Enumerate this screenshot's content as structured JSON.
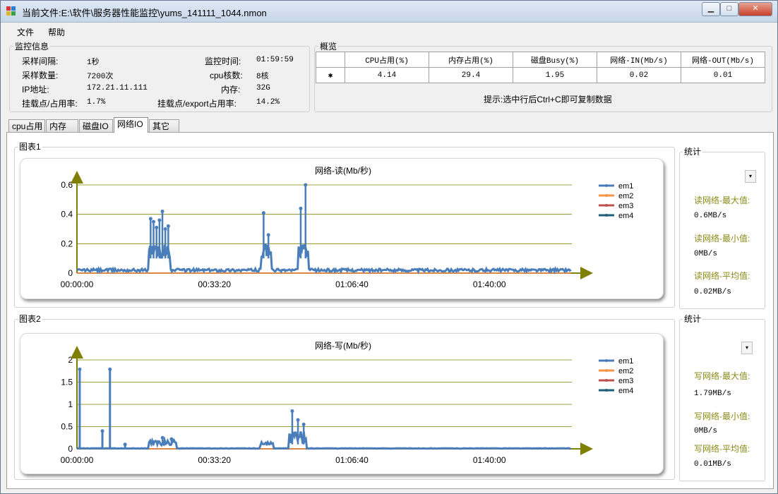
{
  "window": {
    "title": "当前文件:E:\\软件\\服务器性能监控\\yums_141111_1044.nmon",
    "min_glyph": "▁",
    "max_glyph": "□",
    "close_glyph": "✕"
  },
  "menu": {
    "file": "文件",
    "help": "帮助"
  },
  "monitor": {
    "title": "监控信息",
    "interval_label": "采样间隔:",
    "interval_value": "1秒",
    "count_label": "采样数量:",
    "count_value": "7200次",
    "ip_label": "IP地址:",
    "ip_value": "172.21.11.111",
    "mount_label": "挂载点/占用率:",
    "mount_value": "1.7%",
    "time_label": "监控时间:",
    "time_value": "01:59:59",
    "cpu_label": "cpu核数:",
    "cpu_value": "8核",
    "mem_label": "内存:",
    "mem_value": "32G",
    "export_label": "挂载点/export占用率:",
    "export_value": "14.2%"
  },
  "overview": {
    "title": "概览",
    "columns": [
      "CPU占用(%)",
      "内存占用(%)",
      "磁盘Busy(%)",
      "网络-IN(Mb/s)",
      "网络-OUT(Mb/s)"
    ],
    "row_marker": "✱",
    "values": [
      "4.14",
      "29.4",
      "1.95",
      "0.02",
      "0.01"
    ],
    "hint": "提示:选中行后Ctrl+C即可复制数据"
  },
  "tabs": [
    "cpu占用",
    "内存",
    "磁盘IO",
    "网络IO",
    "其它"
  ],
  "active_tab": 3,
  "colors": {
    "em1": "#4a7ebb",
    "em2": "#f79646",
    "em3": "#c0504d",
    "em4": "#1f5f7a",
    "gridline": "#808000",
    "axis_arrow": "#808000"
  },
  "chart1": {
    "group": "图表1",
    "stats_title": "统计",
    "dropdown_glyph": "▾",
    "max_label": "读网络-最大值:",
    "max_value": "0.6MB/s",
    "min_label": "读网络-最小值:",
    "min_value": "0MB/s",
    "avg_label": "读网络-平均值:",
    "avg_value": "0.02MB/s"
  },
  "chart2": {
    "group": "图表2",
    "stats_title": "统计",
    "dropdown_glyph": "▾",
    "max_label": "写网络-最大值:",
    "max_value": "1.79MB/s",
    "min_label": "写网络-最小值:",
    "min_value": "0MB/s",
    "avg_label": "写网络-平均值:",
    "avg_value": "0.01MB/s"
  },
  "chart_data": [
    {
      "type": "line",
      "title": "网络-读(Mb/秒)",
      "xlabel": "",
      "ylabel": "",
      "xlim": [
        "00:00:00",
        "01:59:59"
      ],
      "x_ticks": [
        "00:00:00",
        "00:33:20",
        "01:06:40",
        "01:40:00"
      ],
      "ylim": [
        0,
        0.6
      ],
      "y_ticks": [
        "0",
        "0.2",
        "0.4",
        "0.6"
      ],
      "grid": true,
      "legend": "top-right",
      "series": [
        {
          "name": "em1",
          "baseline": 0.02,
          "bursts": [
            {
              "from": "00:17:30",
              "to": "00:22:30",
              "low": 0.1,
              "high": 0.2,
              "peaks": [
                0.37,
                0.35,
                0.31,
                0.36,
                0.42,
                0.3,
                0.32
              ]
            },
            {
              "from": "00:44:40",
              "to": "00:47:00",
              "low": 0.1,
              "high": 0.2,
              "peaks": [
                0.41,
                0.26
              ]
            },
            {
              "from": "00:53:40",
              "to": "00:56:00",
              "low": 0.1,
              "high": 0.2,
              "peaks": [
                0.44,
                0.6
              ]
            }
          ]
        },
        {
          "name": "em2",
          "baseline": 0
        },
        {
          "name": "em3",
          "baseline": 0
        },
        {
          "name": "em4",
          "baseline": 0
        }
      ]
    },
    {
      "type": "line",
      "title": "网络-写(Mb/秒)",
      "xlabel": "",
      "ylabel": "",
      "xlim": [
        "00:00:00",
        "01:59:59"
      ],
      "x_ticks": [
        "00:00:00",
        "00:33:20",
        "01:06:40",
        "01:40:00"
      ],
      "ylim": [
        0,
        2
      ],
      "y_ticks": [
        "0",
        "0.5",
        "1",
        "1.5",
        "2"
      ],
      "grid": true,
      "legend": "top-right",
      "series": [
        {
          "name": "em1",
          "baseline": 0.01,
          "spikes": [
            {
              "t": "00:00:40",
              "v": 1.79
            },
            {
              "t": "00:06:10",
              "v": 0.4
            },
            {
              "t": "00:08:00",
              "v": 1.79
            },
            {
              "t": "00:11:40",
              "v": 0.1
            }
          ],
          "bursts": [
            {
              "from": "00:17:30",
              "to": "00:24:00",
              "low": 0.08,
              "high": 0.2,
              "peaks": [
                0.15,
                0.25,
                0.22
              ]
            },
            {
              "from": "00:44:30",
              "to": "00:47:30",
              "low": 0.08,
              "high": 0.15,
              "peaks": [
                0.12
              ]
            },
            {
              "from": "00:51:30",
              "to": "00:55:40",
              "low": 0.1,
              "high": 0.4,
              "peaks": [
                0.85,
                0.65,
                0.55
              ]
            }
          ]
        },
        {
          "name": "em2",
          "baseline": 0
        },
        {
          "name": "em3",
          "baseline": 0
        },
        {
          "name": "em4",
          "baseline": 0
        }
      ]
    }
  ]
}
